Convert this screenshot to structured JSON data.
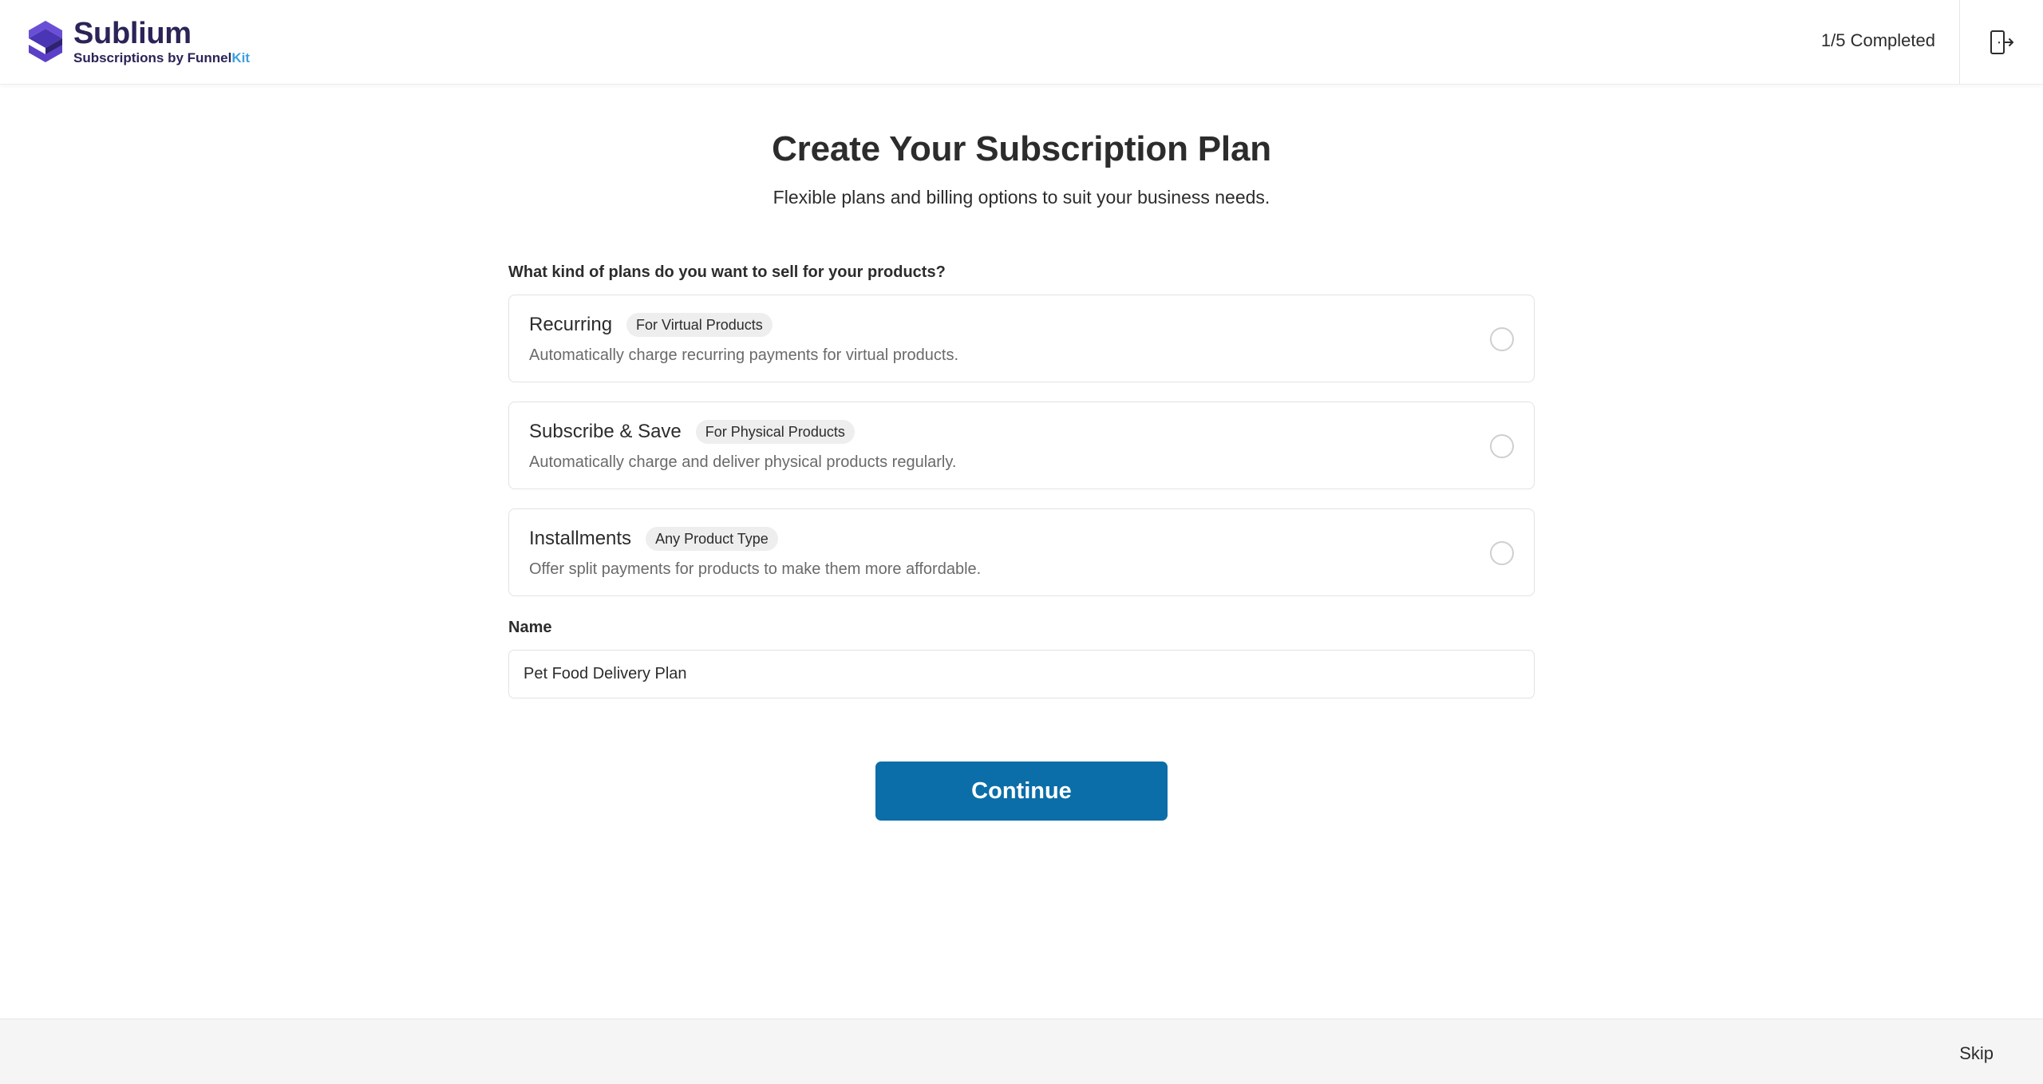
{
  "header": {
    "logo_title": "Sublium",
    "logo_sub_prefix": "Subscriptions by Funnel",
    "logo_sub_suffix": "Kit",
    "progress": "1/5 Completed",
    "exit_icon": "exit-icon"
  },
  "main": {
    "title": "Create Your Subscription Plan",
    "subtitle": "Flexible plans and billing options to suit your business needs.",
    "question": "What kind of plans do you want to sell for your products?",
    "options": [
      {
        "title": "Recurring",
        "badge": "For Virtual Products",
        "description": "Automatically charge recurring payments for virtual products.",
        "selected": false
      },
      {
        "title": "Subscribe & Save",
        "badge": "For Physical Products",
        "description": "Automatically charge and deliver physical products regularly.",
        "selected": false
      },
      {
        "title": "Installments",
        "badge": "Any Product Type",
        "description": "Offer split payments for products to make them more affordable.",
        "selected": false
      }
    ],
    "name_label": "Name",
    "name_value": "Pet Food Delivery Plan",
    "continue_label": "Continue"
  },
  "footer": {
    "skip_label": "Skip"
  },
  "colors": {
    "brand": "#2a2458",
    "brand_accent": "#3aa0e0",
    "primary_button": "#0b6ea8",
    "logo_purple": "#5b3fc7"
  }
}
